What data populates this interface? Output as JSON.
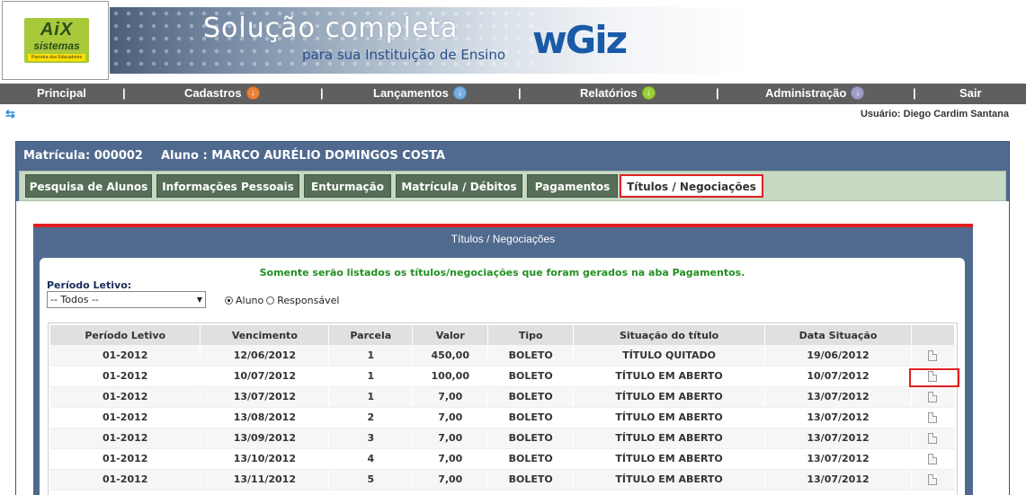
{
  "header": {
    "logo_title": "AiX",
    "logo_sub": "sistemas",
    "logo_tag": "Parceira dos Educadores",
    "banner_title": "Solução completa",
    "banner_sub": "para sua Instituição de Ensino",
    "brand": "wGiz"
  },
  "menu": {
    "items": [
      {
        "label": "Principal",
        "icon": null
      },
      {
        "label": "Cadastros",
        "icon": "orange-arrow-down-icon"
      },
      {
        "label": "Lançamentos",
        "icon": "blue-arrow-down-icon"
      },
      {
        "label": "Relatórios",
        "icon": "green-arrow-down-icon"
      },
      {
        "label": "Administração",
        "icon": "purple-arrow-down-icon"
      },
      {
        "label": "Sair",
        "icon": null
      }
    ],
    "separator": "|"
  },
  "toggle_icon": "expand-collapse-icon",
  "user_line": "Usuário: Diego Cardim Santana",
  "student": {
    "matricula": "Matrícula: 000002",
    "aluno": "Aluno : MARCO AURÉLIO DOMINGOS COSTA"
  },
  "tabs": [
    {
      "label": "Pesquisa de Alunos",
      "active": false
    },
    {
      "label": "Informações Pessoais",
      "active": false
    },
    {
      "label": "Enturmação",
      "active": false
    },
    {
      "label": "Matrícula / Débitos",
      "active": false
    },
    {
      "label": "Pagamentos",
      "active": false
    },
    {
      "label": "Títulos / Negociações",
      "active": true
    }
  ],
  "section": {
    "title": "Títulos / Negociações",
    "notice": "Somente serão listados os títulos/negociações que foram gerados na aba Pagamentos.",
    "period_label": "Período Letivo:",
    "period_value": "-- Todos --",
    "radio_aluno": "Aluno",
    "radio_responsavel": "Responsável",
    "radio_selected": "Aluno"
  },
  "table": {
    "columns": [
      "Período Letivo",
      "Vencimento",
      "Parcela",
      "Valor",
      "Tipo",
      "Situação do título",
      "Data Situação",
      ""
    ],
    "rows": [
      [
        "01-2012",
        "12/06/2012",
        "1",
        "450,00",
        "BOLETO",
        "TÍTULO QUITADO",
        "19/06/2012"
      ],
      [
        "01-2012",
        "10/07/2012",
        "1",
        "100,00",
        "BOLETO",
        "TÍTULO EM ABERTO",
        "10/07/2012"
      ],
      [
        "01-2012",
        "13/07/2012",
        "1",
        "7,00",
        "BOLETO",
        "TÍTULO EM ABERTO",
        "13/07/2012"
      ],
      [
        "01-2012",
        "13/08/2012",
        "2",
        "7,00",
        "BOLETO",
        "TÍTULO EM ABERTO",
        "13/07/2012"
      ],
      [
        "01-2012",
        "13/09/2012",
        "3",
        "7,00",
        "BOLETO",
        "TÍTULO EM ABERTO",
        "13/07/2012"
      ],
      [
        "01-2012",
        "13/10/2012",
        "4",
        "7,00",
        "BOLETO",
        "TÍTULO EM ABERTO",
        "13/07/2012"
      ],
      [
        "01-2012",
        "13/11/2012",
        "5",
        "7,00",
        "BOLETO",
        "TÍTULO EM ABERTO",
        "13/07/2012"
      ]
    ],
    "row_icon": "document-icon"
  },
  "colors": {
    "menu_bg": "#5f5f5f",
    "panel_bg": "#4f6a8e",
    "tab_bg": "#566e57",
    "highlight": "#e02020",
    "notice": "#219021"
  }
}
